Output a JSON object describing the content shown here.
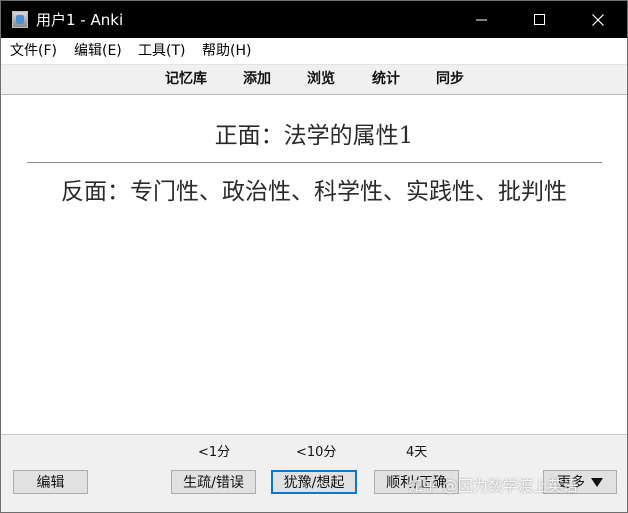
{
  "window": {
    "title": "用户1 - Anki"
  },
  "menubar": {
    "items": [
      {
        "label": "文件(F)"
      },
      {
        "label": "编辑(E)"
      },
      {
        "label": "工具(T)"
      },
      {
        "label": "帮助(H)"
      }
    ]
  },
  "toolbar": {
    "items": [
      {
        "label": "记忆库"
      },
      {
        "label": "添加"
      },
      {
        "label": "浏览"
      },
      {
        "label": "统计"
      },
      {
        "label": "同步"
      }
    ]
  },
  "card": {
    "front": "正面：法学的属性1",
    "back": "反面：专门性、政治性、科学性、实践性、批判性"
  },
  "bottombar": {
    "edit_label": "编辑",
    "intervals": [
      "<1分",
      "<10分",
      "4天"
    ],
    "answers": [
      {
        "label": "生疏/错误"
      },
      {
        "label": "犹豫/想起"
      },
      {
        "label": "顺利/正确"
      }
    ],
    "more_label": "更多"
  },
  "watermark": "知乎 @因为数学渡上英语"
}
